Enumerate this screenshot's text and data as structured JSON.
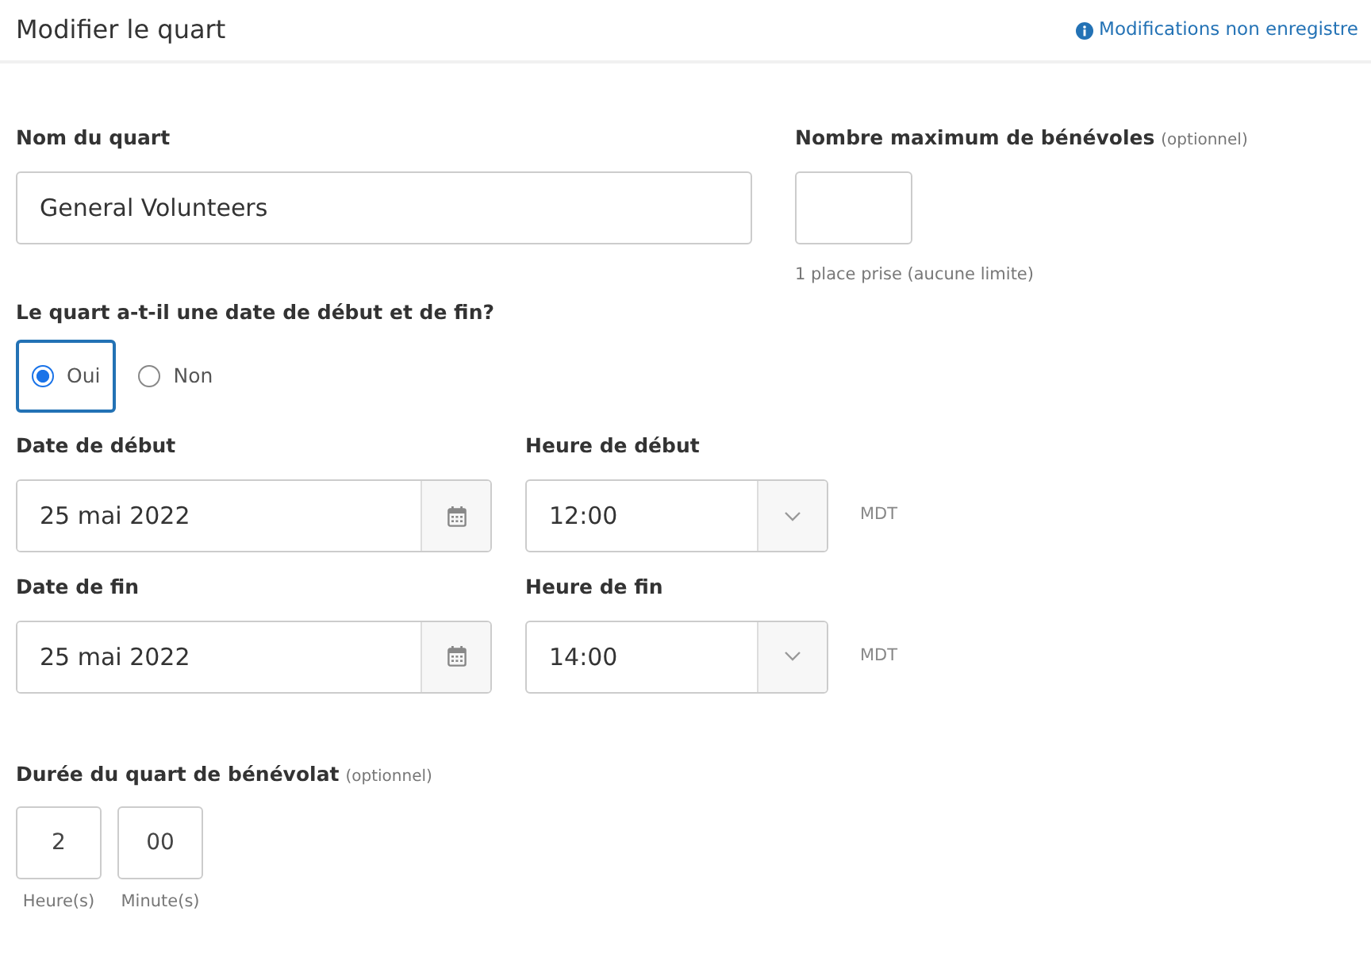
{
  "header": {
    "title": "Modifier le quart",
    "notice": "Modifications non enregistre"
  },
  "shift_name": {
    "label": "Nom du quart",
    "value": "General Volunteers"
  },
  "max_volunteers": {
    "label": "Nombre maximum de bénévoles",
    "note": "(optionnel)",
    "help": "1 place prise (aucune limite)"
  },
  "has_dates": {
    "label": "Le quart a-t-il une date de début et de fin?",
    "options": [
      {
        "label": "Oui",
        "selected": true
      },
      {
        "label": "Non",
        "selected": false
      }
    ]
  },
  "dates": [
    {
      "date_label": "Date de début",
      "date": "25 mai 2022",
      "time_label": "Heure de début",
      "time": "12:00",
      "timezone": "MDT"
    },
    {
      "date_label": "Date de fin",
      "date": "25 mai 2022",
      "time_label": "Heure de fin",
      "time": "14:00",
      "timezone": "MDT"
    }
  ],
  "duration": {
    "label": "Durée du quart de bénévolat",
    "note": "(optionnel)",
    "fields": [
      {
        "value": "2",
        "caption": "Heure(s)"
      },
      {
        "value": "00",
        "caption": "Minute(s)"
      }
    ]
  }
}
